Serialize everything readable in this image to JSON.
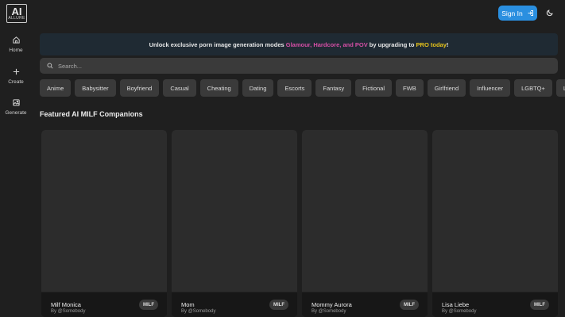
{
  "header": {
    "logo_text": "AI",
    "logo_subtext": "ALLURE",
    "signin_label": "Sign In",
    "signin_icon": "sign-in-icon",
    "theme_icon": "moon-icon"
  },
  "sidebar": {
    "items": [
      {
        "label": "Home",
        "icon": "home-icon"
      },
      {
        "label": "Create",
        "icon": "plus-icon"
      },
      {
        "label": "Generate",
        "icon": "image-icon"
      }
    ]
  },
  "banner": {
    "text_before": "Unlock exclusive porn image generation modes ",
    "highlight_modes": "Glamour, Hardcore, and POV",
    "text_middle": " by upgrading to ",
    "highlight_pro": "PRO today",
    "text_after": "!",
    "colors": {
      "modes": "#d64fa6",
      "pro": "#e8c41a"
    }
  },
  "search": {
    "placeholder": "Search...",
    "value": ""
  },
  "categories": [
    "Anime",
    "Babysitter",
    "Boyfriend",
    "Casual",
    "Cheating",
    "Dating",
    "Escorts",
    "Fantasy",
    "Fictional",
    "FWB",
    "Girlfriend",
    "Influencer",
    "LGBTQ+",
    "Lon"
  ],
  "section": {
    "title": "Featured AI MILF Companions"
  },
  "cards": [
    {
      "name": "Milf Monica",
      "author": "By @Somebody",
      "tag": "MILF"
    },
    {
      "name": "Mom",
      "author": "By @Somebody",
      "tag": "MILF"
    },
    {
      "name": "Mommy Aurora",
      "author": "By @Somebody",
      "tag": "MILF"
    },
    {
      "name": "Lisa Liebe",
      "author": "By @Somebody",
      "tag": "MILF"
    }
  ],
  "colors": {
    "accent": "#2a8fe0",
    "background": "#1f1f1f"
  }
}
